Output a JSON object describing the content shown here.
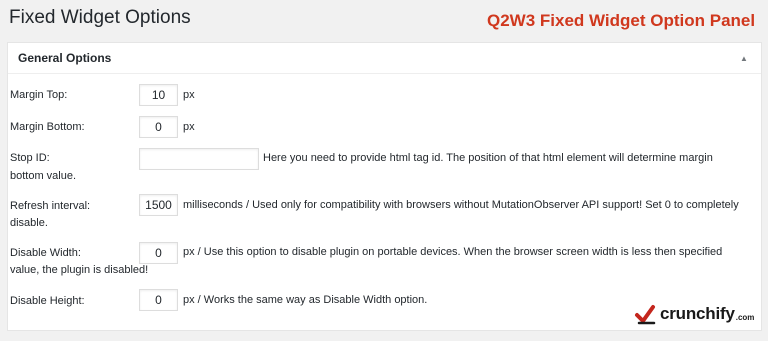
{
  "page": {
    "title": "Fixed Widget Options",
    "overlay_title": "Q2W3 Fixed Widget Option Panel"
  },
  "panel": {
    "title": "General Options",
    "toggle_icon": "triangle-up-icon"
  },
  "fields": {
    "margin_top": {
      "label": "Margin Top:",
      "value": "10",
      "unit": "px"
    },
    "margin_bottom": {
      "label": "Margin Bottom:",
      "value": "0",
      "unit": "px"
    },
    "stop_id": {
      "label": "Stop ID:",
      "value": "",
      "desc_line1": "Here you need to provide html tag id. The position of that html element will determine margin",
      "desc_line2": "bottom value."
    },
    "refresh_interval": {
      "label": "Refresh interval:",
      "value": "1500",
      "desc_line1": "milliseconds / Used only for compatibility with browsers without MutationObserver API support! Set 0 to completely",
      "desc_line2": "disable."
    },
    "disable_width": {
      "label": "Disable Width:",
      "value": "0",
      "desc_line1": "px / Use this option to disable plugin on portable devices. When the browser screen width is less then specified",
      "desc_line2": "value, the plugin is disabled!"
    },
    "disable_height": {
      "label": "Disable Height:",
      "value": "0",
      "desc": "px / Works the same way as Disable Width option."
    }
  },
  "branding": {
    "logo_text": "crunchify",
    "logo_suffix": ".com",
    "logo_icon": "crunchify-logo-icon",
    "accent_color": "#d0381e"
  }
}
